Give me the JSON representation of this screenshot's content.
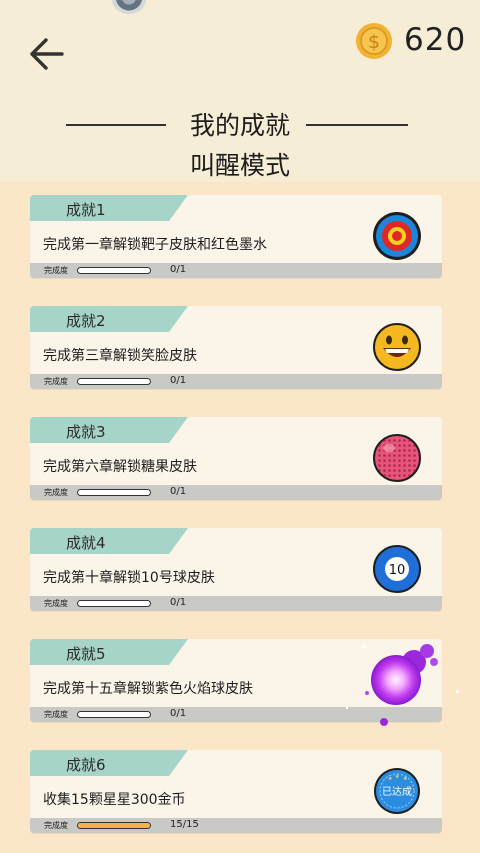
{
  "header": {
    "coin_count": "620",
    "title": "我的成就",
    "subtitle": "叫醒模式"
  },
  "progress_label": "完成度",
  "achievements": [
    {
      "name": "成就1",
      "desc": "完成第一章解锁靶子皮肤和红色墨水",
      "progress_text": "0/1",
      "progress": 0,
      "badge": "target-icon"
    },
    {
      "name": "成就2",
      "desc": "完成第三章解锁笑脸皮肤",
      "progress_text": "0/1",
      "progress": 0,
      "badge": "smiley-icon"
    },
    {
      "name": "成就3",
      "desc": "完成第六章解锁糖果皮肤",
      "progress_text": "0/1",
      "progress": 0,
      "badge": "candy-ball-icon"
    },
    {
      "name": "成就4",
      "desc": "完成第十章解锁10号球皮肤",
      "progress_text": "0/1",
      "progress": 0,
      "badge": "billiard-ball-icon",
      "badge_text": "10"
    },
    {
      "name": "成就5",
      "desc": "完成第十五章解锁紫色火焰球皮肤",
      "progress_text": "0/1",
      "progress": 0,
      "badge": "purple-fire-ball-icon"
    },
    {
      "name": "成就6",
      "desc": "收集15颗星星300金币",
      "progress_text": "15/15",
      "progress": 1,
      "badge": "achieved-stamp-icon",
      "badge_text": "已达成"
    }
  ],
  "colors": {
    "tab": "#a7d4c8",
    "progress_fill": "#f4b24a",
    "background": "#fbe6c8"
  }
}
